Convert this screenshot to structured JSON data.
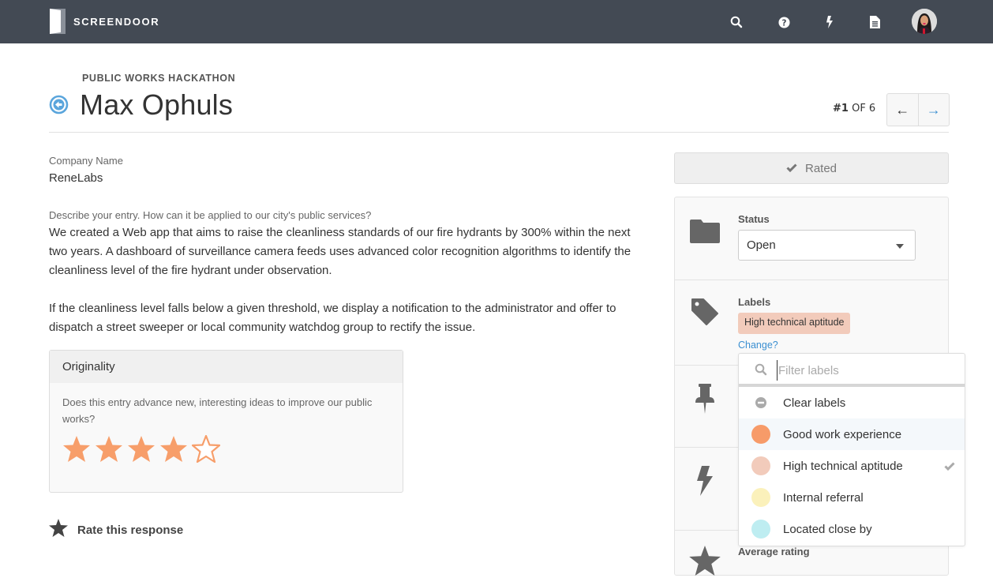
{
  "nav": {
    "brand": "SCREENDOOR",
    "icons": [
      "search-icon",
      "help-icon",
      "bolt-icon",
      "document-icon"
    ],
    "avatar_alt": "User avatar"
  },
  "header": {
    "eyebrow": "PUBLIC WORKS HACKATHON",
    "title": "Max Ophuls",
    "pager_current": "#1",
    "pager_of": " OF 6",
    "prev_label": "←",
    "next_label": "→"
  },
  "response": {
    "company_label": "Company Name",
    "company_value": "ReneLabs",
    "question_label": "Describe your entry. How can it be applied to our city's public services?",
    "answer_paragraphs": [
      "We created a Web app that aims to raise the cleanliness standards of our fire hydrants by 300% within the next two years. A dashboard of surveillance camera feeds uses advanced color recognition algorithms to identify the cleanliness level of the fire hydrant under observation.",
      "If the cleanliness level falls below a given threshold, we display a notification to the administrator and offer to dispatch a street sweeper or local community watchdog group to rectify the issue."
    ]
  },
  "rating_card": {
    "title": "Originality",
    "question": "Does this entry advance new, interesting ideas to improve our public works?",
    "rating": 4,
    "max_rating": 5,
    "star_color": "#f79e6a"
  },
  "rate_this": {
    "label": "Rate this response"
  },
  "sidebar": {
    "rated_label": "Rated",
    "status": {
      "label": "Status",
      "value": "Open"
    },
    "labels": {
      "label": "Labels",
      "current": "High technical aptitude",
      "current_color": "#f2cbbb",
      "change_label": "Change?"
    },
    "average_rating_label": "Average rating"
  },
  "label_dropdown": {
    "placeholder": "Filter labels",
    "value": "",
    "clear_label": "Clear labels",
    "options": [
      {
        "label": "Good work experience",
        "color": "#f79b69",
        "selected": false,
        "hovered": true
      },
      {
        "label": "High technical aptitude",
        "color": "#f2cbbb",
        "selected": true,
        "hovered": false
      },
      {
        "label": "Internal referral",
        "color": "#fbf1bb",
        "selected": false,
        "hovered": false
      },
      {
        "label": "Located close by",
        "color": "#beedf1",
        "selected": false,
        "hovered": false
      }
    ]
  }
}
